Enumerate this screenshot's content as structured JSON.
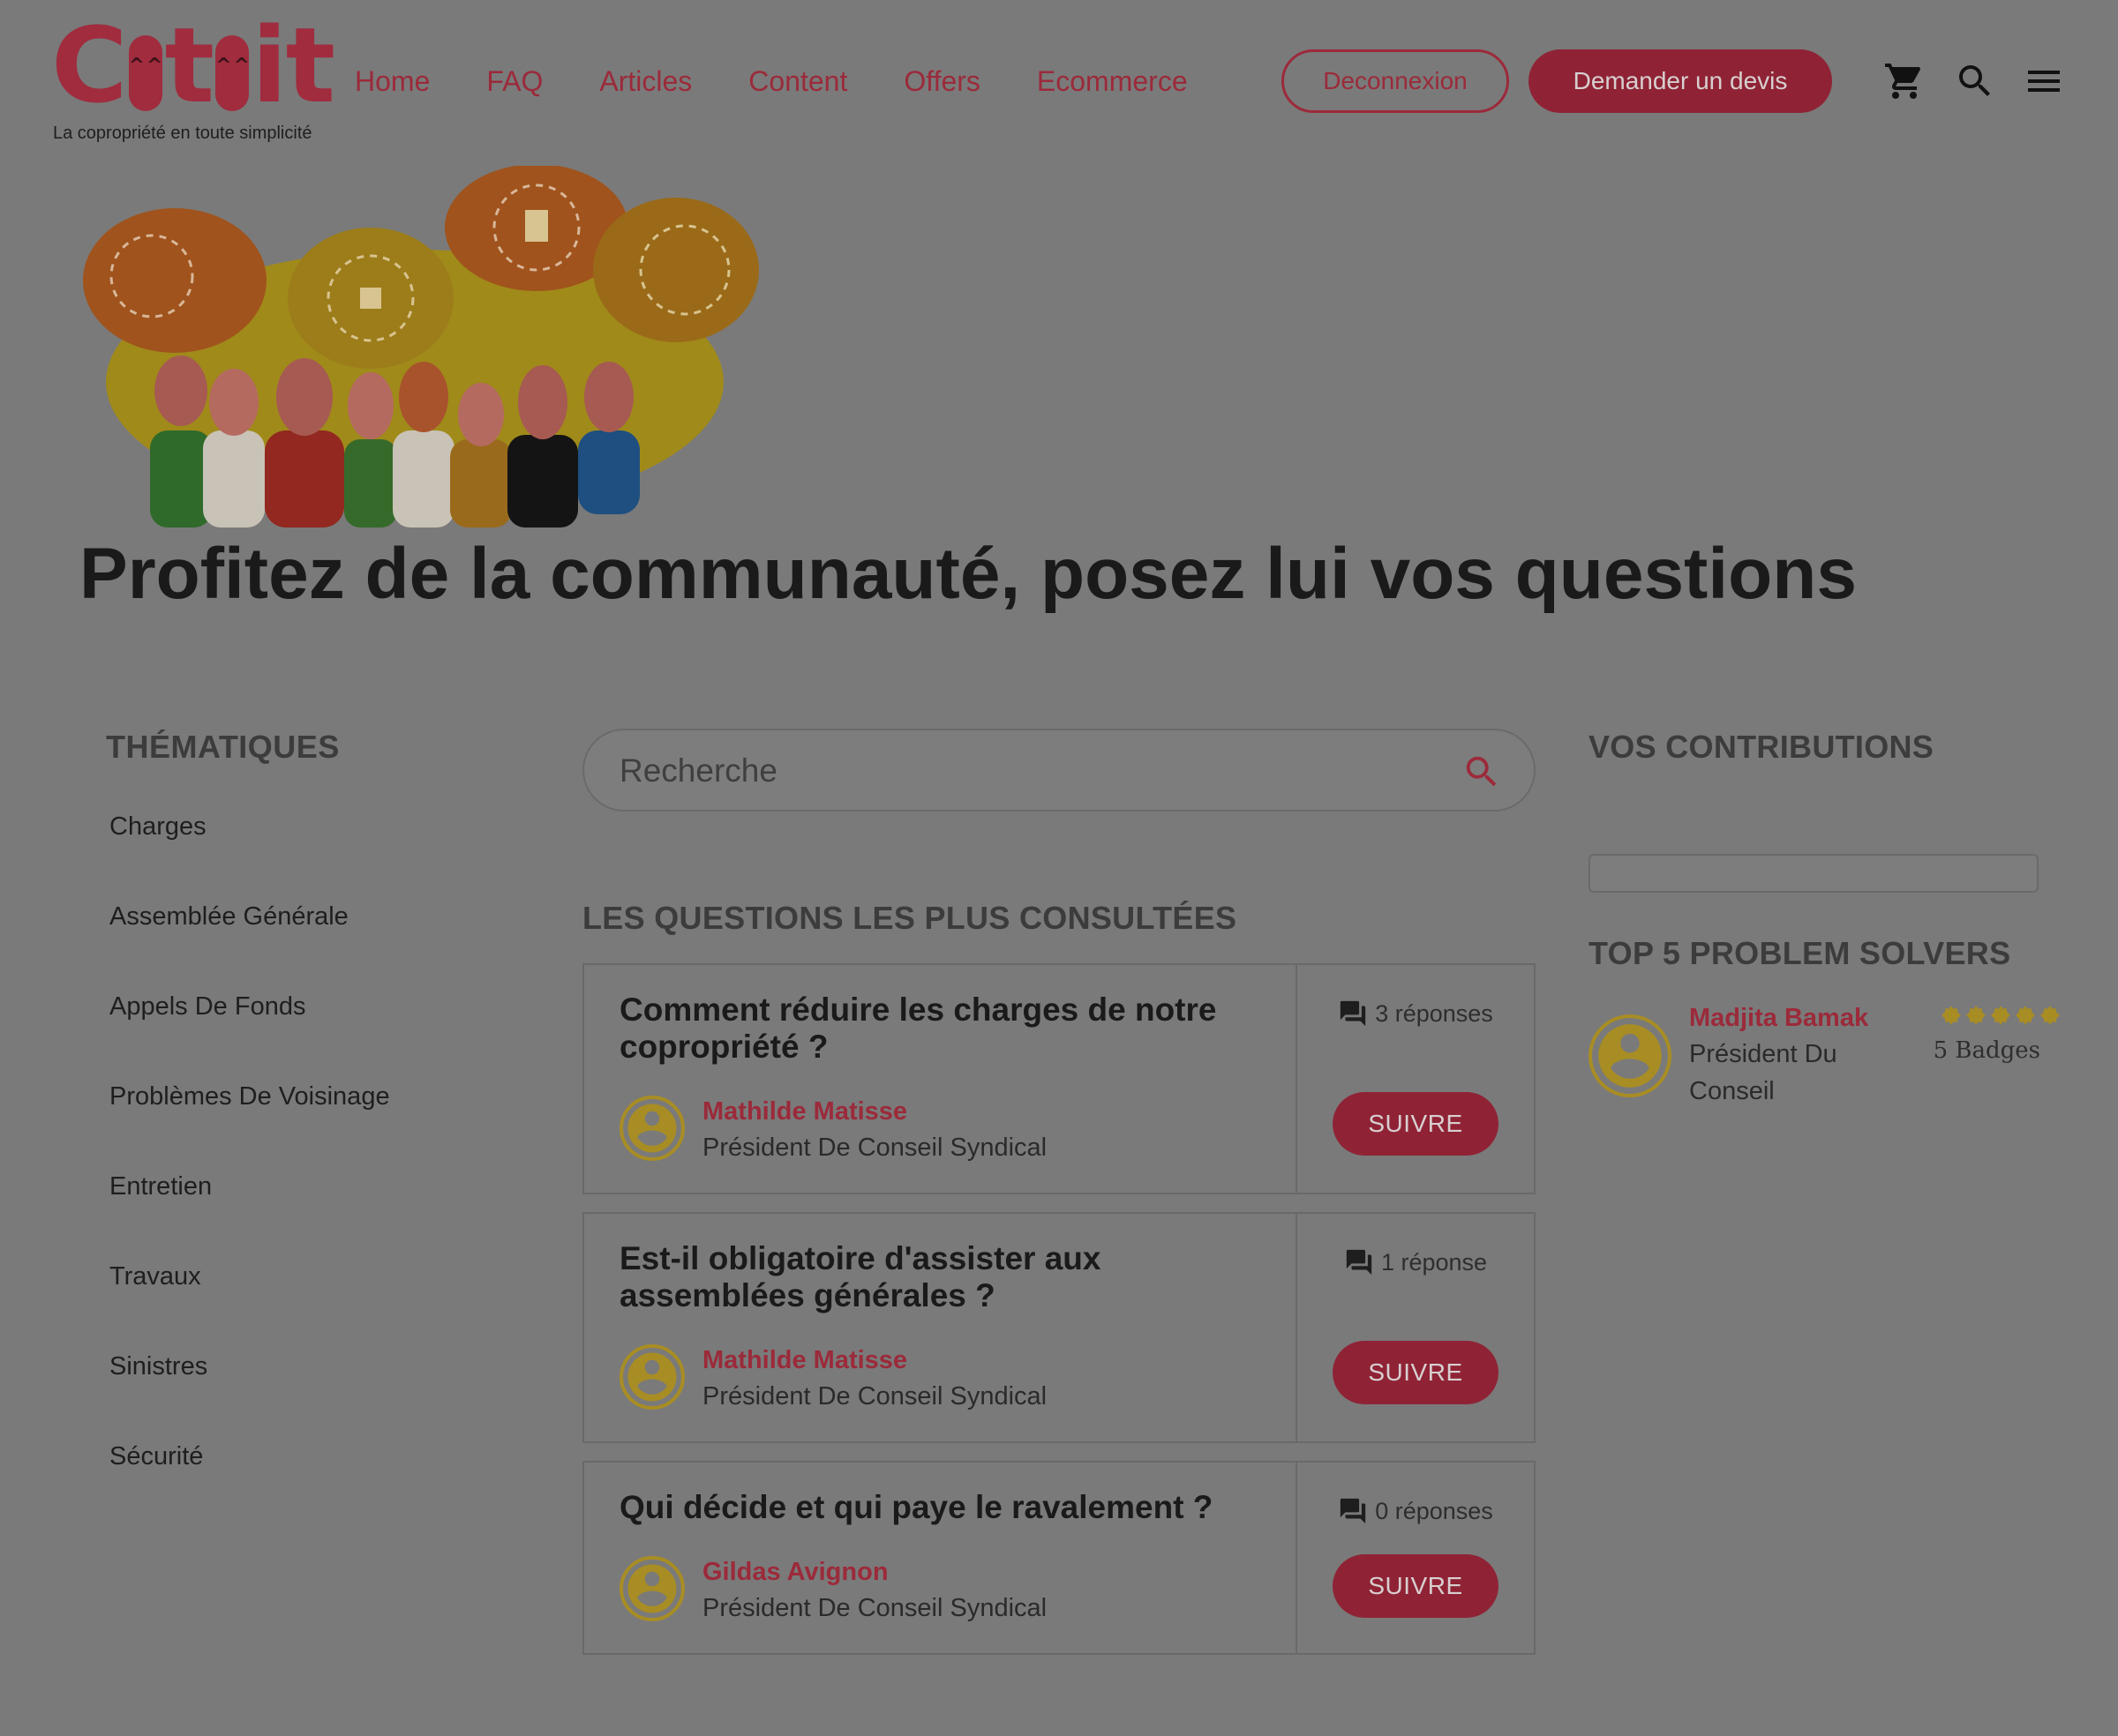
{
  "header": {
    "logo_text": "Coproit",
    "logo_tagline": "La copropriété en toute simplicité",
    "nav": [
      "Home",
      "FAQ",
      "Articles",
      "Content",
      "Offers",
      "Ecommerce"
    ],
    "logout_label": "Deconnexion",
    "quote_label": "Demander un devis",
    "icons": [
      "cart-icon",
      "search-icon",
      "menu-icon"
    ]
  },
  "hero": {
    "title": "Profitez de la communauté, posez lui vos questions"
  },
  "sidebar": {
    "title": "THÉMATIQUES",
    "items": [
      "Charges",
      "Assemblée Générale",
      "Appels De Fonds",
      "Problèmes De Voisinage",
      "Entretien",
      "Travaux",
      "Sinistres",
      "Sécurité"
    ]
  },
  "search": {
    "placeholder": "Recherche"
  },
  "questions": {
    "section_title": "LES QUESTIONS LES PLUS CONSULTÉES",
    "follow_label": "SUIVRE",
    "items": [
      {
        "title": "Comment réduire les charges de notre copropriété ?",
        "author": "Mathilde Matisse",
        "role": "Président De Conseil Syndical",
        "answers": "3 réponses"
      },
      {
        "title": "Est-il obligatoire d'assister aux assemblées générales ?",
        "author": "Mathilde Matisse",
        "role": "Président De Conseil Syndical",
        "answers": "1 réponse"
      },
      {
        "title": "Qui décide et qui paye le ravalement ?",
        "author": "Gildas Avignon",
        "role": "Président De Conseil Syndical",
        "answers": "0 réponses"
      }
    ]
  },
  "contributions": {
    "title": "VOS CONTRIBUTIONS"
  },
  "top_solvers": {
    "title": "TOP 5 PROBLEM SOLVERS",
    "items": [
      {
        "name": "Madjita Bamak",
        "role": "Président Du Conseil",
        "badges": "5 Badges",
        "badge_count": 5
      }
    ]
  },
  "colors": {
    "page_overlay": "#7a7a7a",
    "brand": "#9b2a3a",
    "button": "#8f2335",
    "avatar_ring": "#a88d24"
  }
}
